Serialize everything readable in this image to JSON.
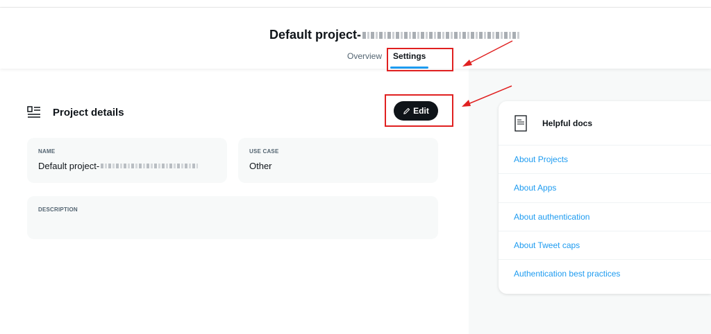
{
  "header": {
    "title": "Default project-",
    "tabs": [
      {
        "label": "Overview",
        "active": false
      },
      {
        "label": "Settings",
        "active": true
      }
    ]
  },
  "project_details": {
    "section_title": "Project details",
    "edit_label": "Edit",
    "name_label": "NAME",
    "name_value": "Default project-",
    "use_case_label": "USE CASE",
    "use_case_value": "Other",
    "description_label": "DESCRIPTION",
    "description_value": ""
  },
  "helpful_docs": {
    "title": "Helpful docs",
    "links": [
      "About Projects",
      "About Apps",
      "About authentication",
      "About Tweet caps",
      "Authentication best practices"
    ]
  },
  "colors": {
    "accent": "#1d9bf0",
    "button_bg": "#0f1419",
    "card_bg": "#f7f9f9",
    "annotation": "#e02020"
  },
  "icons": [
    "project-details-icon",
    "pencil-icon",
    "document-icon",
    "annotation-arrow"
  ]
}
